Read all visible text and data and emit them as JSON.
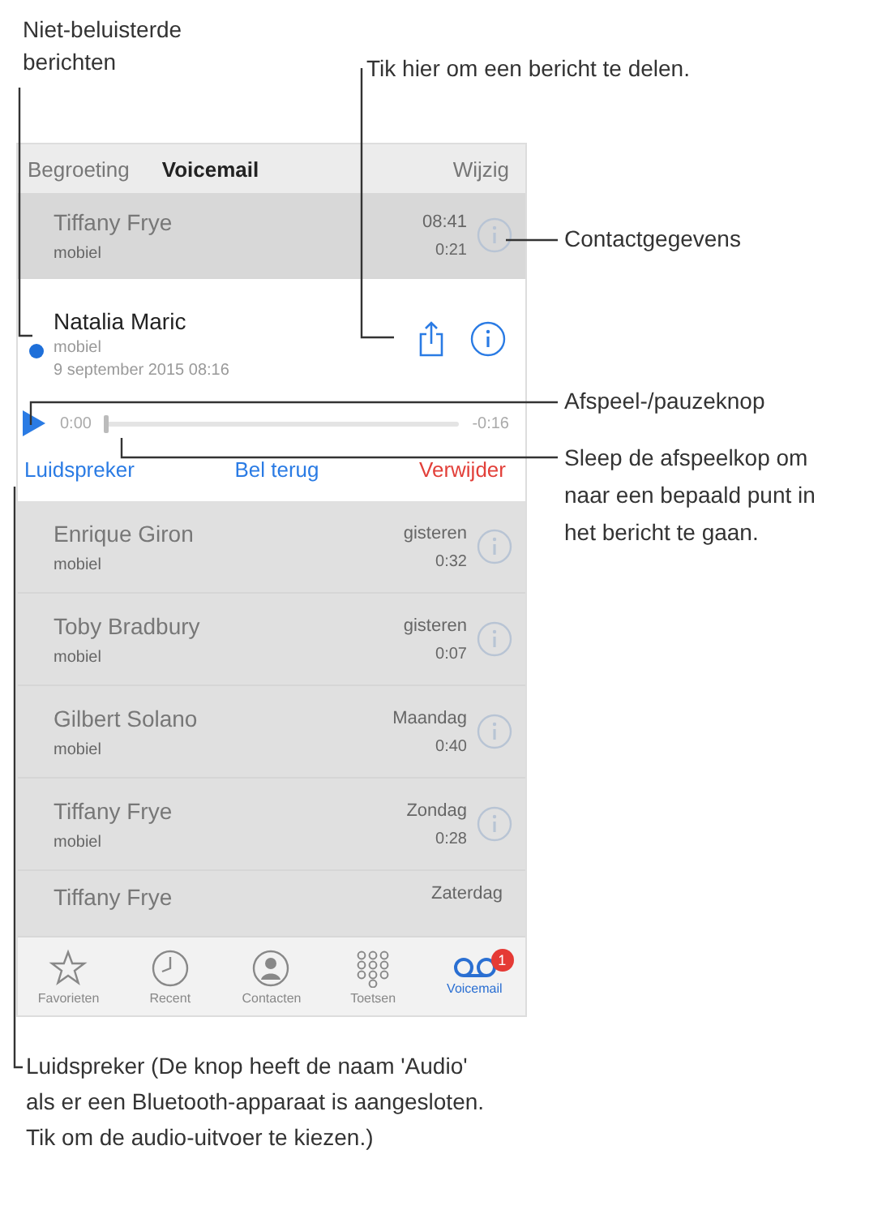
{
  "annotations": {
    "unheard": "Niet-beluisterde berichten",
    "share": "Tik hier om een bericht te delen.",
    "contact": "Contactgegevens",
    "play": "Afspeel-/pauzeknop",
    "scrub": "Sleep de afspeelkop om naar een bepaald punt in het bericht te gaan.",
    "speaker": "Luidspreker (De knop heeft de naam 'Audio' als er een Bluetooth-apparaat is aangesloten. Tik om de audio-uitvoer te kiezen.)"
  },
  "segments": [
    {
      "label": "Begroeting",
      "selected": false
    },
    {
      "label": "Voicemail",
      "selected": true
    }
  ],
  "edit_button": "Wijzig",
  "messages": [
    {
      "name": "Tiffany Frye",
      "detail": "mobiel",
      "time": "08:41",
      "duration": "0:21",
      "unheard": false,
      "expanded": false
    },
    {
      "name": "Natalia Maric",
      "detail": "mobiel",
      "date": "9 september 2015 08:16",
      "elapsed": "0:00",
      "remaining": "-0:16",
      "level": 0,
      "unheard": true,
      "expanded": true,
      "actions": [
        {
          "label": "Luidspreker",
          "kind": "normal"
        },
        {
          "label": "Bel terug",
          "kind": "normal"
        },
        {
          "label": "Verwijder",
          "kind": "destructive"
        }
      ]
    },
    {
      "name": "Enrique Giron",
      "detail": "mobiel",
      "time": "gisteren",
      "duration": "0:32",
      "unheard": false,
      "expanded": false
    },
    {
      "name": "Toby Bradbury",
      "detail": "mobiel",
      "time": "gisteren",
      "duration": "0:07",
      "unheard": false,
      "expanded": false
    },
    {
      "name": "Gilbert Solano",
      "detail": "mobiel",
      "time": "Maandag",
      "duration": "0:40",
      "unheard": false,
      "expanded": false
    },
    {
      "name": "Tiffany Frye",
      "detail": "mobiel",
      "time": "Zondag",
      "duration": "0:28",
      "unheard": false,
      "expanded": false
    },
    {
      "name": "Tiffany Frye",
      "time": "Zaterdag",
      "unheard": false,
      "expanded": false
    }
  ],
  "tab_bar": [
    {
      "label": "Favorieten",
      "kind": "star",
      "selected": false
    },
    {
      "label": "Recent",
      "kind": "clock",
      "selected": false
    },
    {
      "label": "Contacten",
      "kind": "person",
      "selected": false
    },
    {
      "label": "Toetsen",
      "kind": "keypad",
      "selected": false
    },
    {
      "label": "Voicemail",
      "kind": "voicemail",
      "selected": true,
      "badge": "1"
    }
  ]
}
